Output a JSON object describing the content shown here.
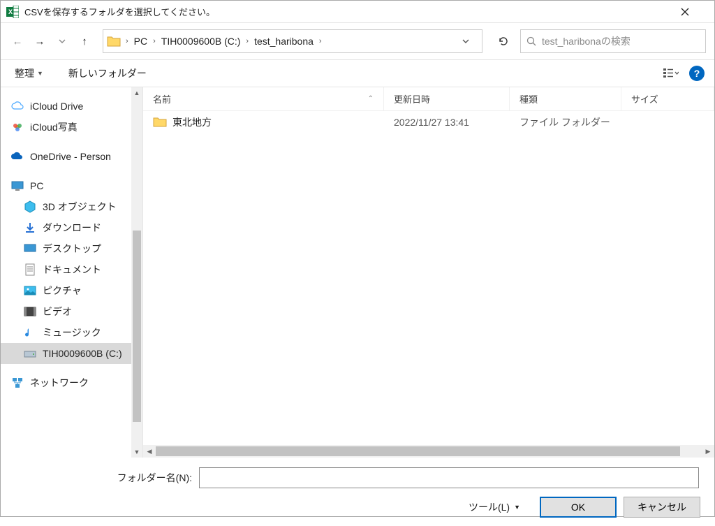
{
  "titlebar": {
    "title": "CSVを保存するフォルダを選択してください。"
  },
  "breadcrumbs": [
    "PC",
    "TIH0009600B (C:)",
    "test_haribona"
  ],
  "search": {
    "placeholder": "test_haribonaの検索"
  },
  "toolbar": {
    "organize": "整理",
    "new_folder": "新しいフォルダー"
  },
  "sidebar": {
    "icloud_drive": "iCloud Drive",
    "icloud_photos": "iCloud写真",
    "onedrive": "OneDrive - Person",
    "pc": "PC",
    "pc_children": [
      "3D オブジェクト",
      "ダウンロード",
      "デスクトップ",
      "ドキュメント",
      "ピクチャ",
      "ビデオ",
      "ミュージック",
      "TIH0009600B (C:)"
    ],
    "network": "ネットワーク"
  },
  "columns": {
    "name": "名前",
    "date": "更新日時",
    "type": "種類",
    "size": "サイズ"
  },
  "files": [
    {
      "name": "東北地方",
      "date": "2022/11/27 13:41",
      "type": "ファイル フォルダー"
    }
  ],
  "footer": {
    "folder_name_label": "フォルダー名(N):",
    "folder_name_value": "",
    "tools": "ツール(L)",
    "ok": "OK",
    "cancel": "キャンセル"
  }
}
